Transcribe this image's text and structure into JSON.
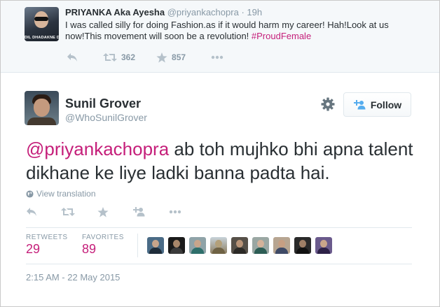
{
  "parent_tweet": {
    "avatar_poster_text": "DIL DHADAKNE DO",
    "name": "PRIYANKA Aka Ayesha",
    "handle": "@priyankachopra",
    "separator": "·",
    "time": "19h",
    "text": "I was called silly for doing Fashion.as if it would harm my career! Hah!Look at us now!This movement will soon be a revolution! ",
    "hashtag": "#ProudFemale",
    "retweet_count": "362",
    "favorite_count": "857"
  },
  "main_tweet": {
    "name": "Sunil Grover",
    "handle": "@WhoSunilGrover",
    "follow_label": "Follow",
    "mention": "@priyankachopra",
    "text": " ab toh mujhko bhi apna talent dikhane ke liye ladki banna padta hai.",
    "view_translation": "View translation",
    "retweets_label": "RETWEETS",
    "retweets_value": "29",
    "favorites_label": "FAVORITES",
    "favorites_value": "89",
    "timestamp": "2:15 AM - 22 May 2015"
  },
  "icons": {
    "reply": "reply-icon",
    "retweet": "retweet-icon",
    "favorite": "star-icon",
    "more": "more-dots-icon",
    "follow": "add-user-icon",
    "settings": "gear-icon",
    "translate": "globe-icon"
  },
  "colors": {
    "accent": "#c51f7a",
    "muted": "#8899a6",
    "text": "#292f33",
    "parent_bg": "#f5f8fa"
  }
}
